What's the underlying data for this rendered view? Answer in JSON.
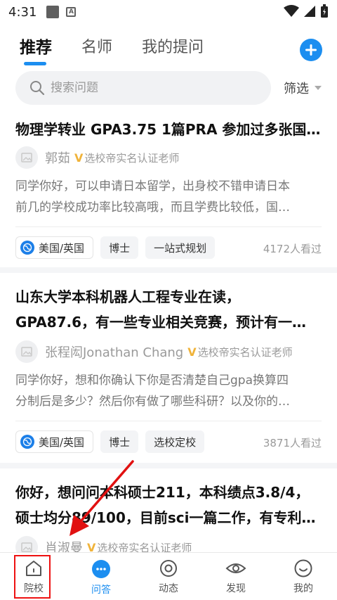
{
  "status_bar": {
    "time": "4:31",
    "a_icon_letter": "A"
  },
  "header": {
    "tabs": [
      {
        "label": "推荐",
        "active": true
      },
      {
        "label": "名师",
        "active": false
      },
      {
        "label": "我的提问",
        "active": false
      }
    ],
    "add_icon": "plus-icon"
  },
  "search": {
    "placeholder": "搜索问题",
    "filter_label": "筛选"
  },
  "questions": [
    {
      "title_lines": [
        "物理学转业 GPA3.75 1篇PRA 参加过多张国…"
      ],
      "author": "郭茹",
      "verify_text": "选校帝实名认证老师",
      "answer_lines": [
        "同学你好，可以申请日本留学，出身校不错申请日本",
        "前几的学校成功率比较高哦，而且学费比较低，国…"
      ],
      "tags": [
        "美国/英国",
        "博士",
        "一站式规划"
      ],
      "views": "4172人看过"
    },
    {
      "title_lines": [
        "山东大学本科机器人工程专业在读，",
        "GPA87.6，有一些专业相关竞赛，预计有一…"
      ],
      "author": "张程闳Jonathan Chang",
      "verify_text": "选校帝实名认证老师",
      "answer_lines": [
        "同学你好，想和你确认下你是否清楚自己gpa换算四",
        "分制后是多少？然后你有做了哪些科研？以及你的…"
      ],
      "tags": [
        "美国/英国",
        "博士",
        "选校定校"
      ],
      "views": "3871人看过"
    },
    {
      "title_lines": [
        "你好，想问问本科硕士211，本科绩点3.8/4，",
        "硕士均分89/100，目前sci一篇二作，有专利…"
      ],
      "author": "肖淑曼",
      "verify_text": "选校帝实名认证老师"
    }
  ],
  "bottom_nav": [
    {
      "label": "院校",
      "icon": "home-icon",
      "active": false
    },
    {
      "label": "问答",
      "icon": "chat-bubble-icon",
      "active": true
    },
    {
      "label": "动态",
      "icon": "circle-dot-icon",
      "active": false
    },
    {
      "label": "发现",
      "icon": "eye-icon",
      "active": false
    },
    {
      "label": "我的",
      "icon": "smiley-icon",
      "active": false
    }
  ],
  "colors": {
    "accent": "#1c8ef0",
    "annotation": "#e11111",
    "badge": "#f0b33a"
  }
}
